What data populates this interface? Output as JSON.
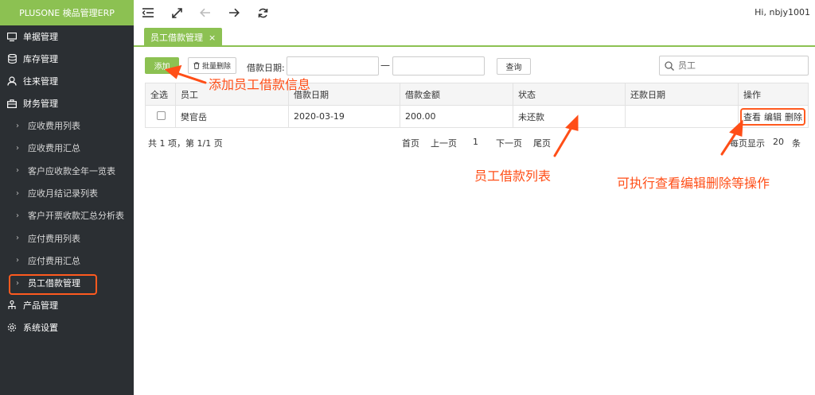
{
  "app": {
    "brand": "PLUSONE 検品管理ERP",
    "greeting": "Hi, nbjy1001"
  },
  "sidebar": {
    "items": [
      {
        "label": "单据管理",
        "icon": "monitor-icon"
      },
      {
        "label": "库存管理",
        "icon": "database-icon"
      },
      {
        "label": "往来管理",
        "icon": "user-icon"
      },
      {
        "label": "财务管理",
        "icon": "briefcase-icon"
      }
    ],
    "sub_items": [
      {
        "label": "应收费用列表"
      },
      {
        "label": "应收费用汇总"
      },
      {
        "label": "客户应收款全年一览表"
      },
      {
        "label": "应收月结记录列表"
      },
      {
        "label": "客户开票收款汇总分析表"
      },
      {
        "label": "应付费用列表"
      },
      {
        "label": "应付费用汇总"
      },
      {
        "label": "员工借款管理",
        "active": true
      }
    ],
    "bottom_items": [
      {
        "label": "产品管理",
        "icon": "sitemap-icon"
      },
      {
        "label": "系统设置",
        "icon": "gear-icon"
      }
    ]
  },
  "tabs": {
    "active_label": "员工借款管理",
    "close_symbol": "×"
  },
  "toolbar": {
    "add_label": "添加",
    "batch_delete_label": "批量删除",
    "date_label": "借款日期:",
    "date_separator": "—",
    "query_label": "查询",
    "search_placeholder": "员工"
  },
  "table": {
    "headers": [
      "全选",
      "员工",
      "借款日期",
      "借款金额",
      "状态",
      "还款日期",
      "操作"
    ],
    "rows": [
      {
        "employee": "樊官岳",
        "date": "2020-03-19",
        "amount": "200.00",
        "status": "未还款",
        "repay_date": "",
        "actions": [
          "查看",
          "编辑",
          "删除"
        ]
      }
    ]
  },
  "pager": {
    "summary": "共 1 项，第 1/1 页",
    "first": "首页",
    "prev": "上一页",
    "current": "1",
    "next": "下一页",
    "last": "尾页",
    "per_page_label": "每页显示",
    "per_page_value": "20",
    "per_page_unit": "条"
  },
  "annotations": {
    "add": "添加员工借款信息",
    "list": "员工借款列表",
    "ops": "可执行查看编辑删除等操作",
    "color": "#ff4e17"
  },
  "colors": {
    "brand_green": "#8cc152",
    "sidebar_bg": "#2b2f33",
    "highlight": "#ff5a1f"
  }
}
